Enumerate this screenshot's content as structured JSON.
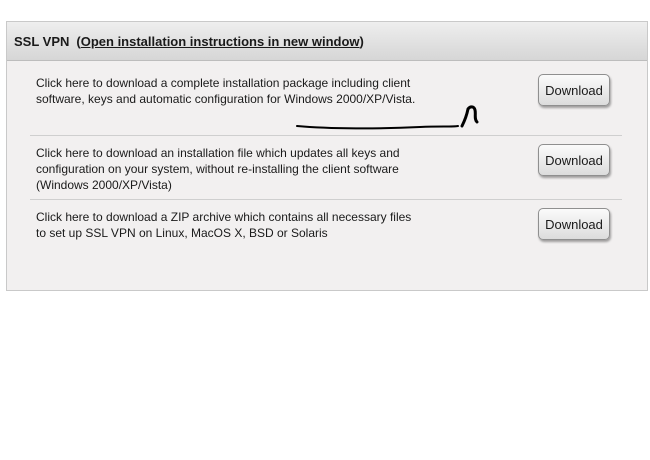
{
  "panel": {
    "title": "SSL VPN",
    "paren_open": "(",
    "link_label": "Open installation instructions in new window",
    "paren_close": ")"
  },
  "rows": [
    {
      "desc_line1": "Click here to download a complete installation package including client",
      "desc_line2": "software, keys and automatic configuration for Windows 2000/XP/Vista.",
      "button_label": "Download"
    },
    {
      "desc_line1": "Click here to download an installation file which updates all keys and",
      "desc_line2": "configuration on your system, without re-installing the client software",
      "desc_line3": "(Windows 2000/XP/Vista)",
      "button_label": "Download"
    },
    {
      "desc_line1": "Click here to download a ZIP archive which contains all necessary files",
      "desc_line2": "to set up SSL VPN on Linux, MacOS X, BSD or Solaris",
      "button_label": "Download"
    }
  ],
  "annotation": {
    "stroke_color": "#000000"
  }
}
